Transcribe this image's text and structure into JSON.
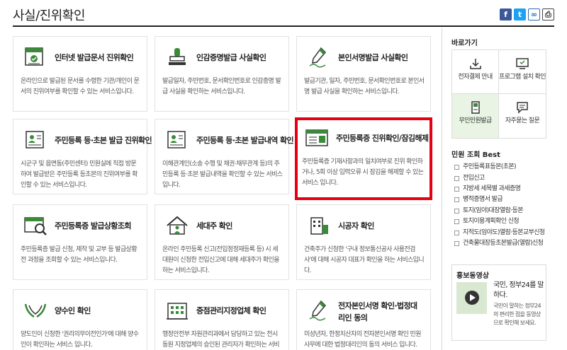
{
  "page": {
    "title": "사실/진위확인"
  },
  "share": {
    "facebook": "f",
    "twitter": "t",
    "link": "∞",
    "print": "⎙"
  },
  "cards": [
    {
      "title": "인터넷 발급문서 진위확인",
      "desc": "온라인으로 발급된 문서를 수령한 기관/개인이 문서의 진위여부를 확인할 수 있는 서비스입니다.",
      "icon": "document-check-icon"
    },
    {
      "title": "인감증명발급 사실확인",
      "desc": "발급일자, 주민번호, 문서확인번호로 인감증명 발급 사실을 확인하는 서비스입니다.",
      "icon": "seal-stamp-icon"
    },
    {
      "title": "본인서명발급 사실확인",
      "desc": "발급기관, 일자, 주민번호, 문서확인번호로 본인서명 발급 사실을 확인하는 서비스입니다.",
      "icon": "pen-signature-icon"
    },
    {
      "title": "주민등록 등·초본 발급 진위확인",
      "desc": "시군구 및 읍면동(주민센터) 민원실에 직접 방문하여 발급받은 주민등록 등초본의 진위여부를 확인할 수 있는 서비스입니다.",
      "icon": "resident-record-icon"
    },
    {
      "title": "주민등록 등·초본 발급내역 확인",
      "desc": "이해관계인(소송 수행 및 채권·채무관계 등)의 주민등록 등·초본 발급내역을 확인할 수 있는 서비스입니다.",
      "icon": "record-history-icon"
    },
    {
      "title": "주민등록증 진위확인/잠김해제",
      "desc": "주민등록증 기재사항과의 일치여부로 진위 확인하거나, 5회 이상 입력오류 시 잠김을 해제할 수 있는 서비스 입니다.",
      "icon": "id-card-icon"
    },
    {
      "title": "주민등록증 발급상황조회",
      "desc": "주민등록증 발급 신청, 제작 및 교부 등 발급상황 전 과정을 조회할 수 있는 서비스입니다.",
      "icon": "id-search-icon"
    },
    {
      "title": "세대주 확인",
      "desc": "온라인 주민등록 신고(전입정정재등록 등) 시 세대원이 신청한 전입신고에 대해 세대주가 확인을 하는 서비스입니다.",
      "icon": "house-icon"
    },
    {
      "title": "시공자 확인",
      "desc": "건축주가 신청한 '구내 정보통신공사 사용전검사'에 대해 시공자 대표가 확인을 하는 서비스입니다.",
      "icon": "building-icon"
    },
    {
      "title": "양수인 확인",
      "desc": "양도인이 신청한 '권리의무이전인가'에 대해 양수인이 확인하는 서비스 입니다.",
      "icon": "hands-icon"
    },
    {
      "title": "중점관리지정업체 확인",
      "desc": "행정안전부 자원관리과에서 담당하고 있는 전시동원 지정업체의 승인된 관리자가 확인하는 서비스 입니다.",
      "icon": "office-building-icon"
    },
    {
      "title": "전자본인서명 확인·법정대리인 동의",
      "desc": "미성년자, 한정치산자의 전자본인서명 확인 민원사무에 대한 법정대리인의 동의 서비스 입니다.",
      "icon": "e-signature-icon"
    }
  ],
  "highlight_card_index": 5,
  "sidebar": {
    "quick_title": "바로가기",
    "quick": [
      {
        "label": "전자결제 안내",
        "icon": "download-icon",
        "active": false
      },
      {
        "label": "프로그램 설치 확인",
        "icon": "monitor-check-icon",
        "active": false
      },
      {
        "label": "무인민원발급",
        "icon": "kiosk-icon",
        "active": true
      },
      {
        "label": "자주묻는 질문",
        "icon": "chat-bubble-icon",
        "active": false
      }
    ],
    "best_title": "민원 조회 Best",
    "best": [
      "주민등록표등본(초본)",
      "전입신고",
      "지방세 세목별 과세증명",
      "병적증명서 발급",
      "토지(임야)대장열람·등본",
      "토지이용계획확인 신청",
      "지적도(임야도)열람·등본교부신청",
      "건축물대장등초본발급(열람)신청"
    ],
    "video": {
      "title": "홍보동영상",
      "headline": "국민, 정부24를 말하다.",
      "desc": "국민이 말하는 정부24의 편리한 점을 동영상으로 확인해 보세요."
    }
  },
  "colors": {
    "accent": "#3a8a3a",
    "highlight": "#e60012",
    "quick_active_bg": "#e9f4e4"
  }
}
